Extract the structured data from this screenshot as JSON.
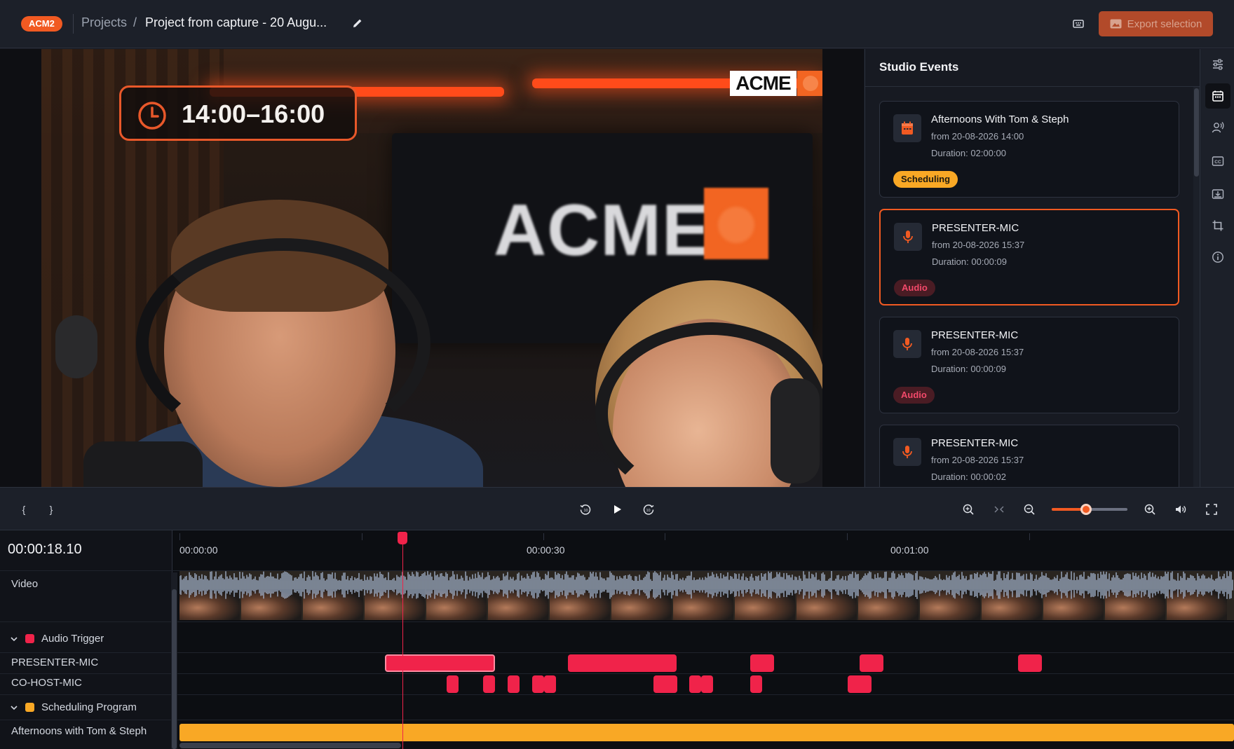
{
  "header": {
    "badge": "ACM2",
    "breadcrumb_projects": "Projects",
    "breadcrumb_sep": "/",
    "project_title": "Project from capture - 20 Augu...",
    "export_label": "Export selection"
  },
  "video": {
    "overlay_time": "14:00–16:00",
    "logo_text": "ACME",
    "monitor_text": "ACME"
  },
  "events_panel": {
    "title": "Studio Events",
    "events": [
      {
        "title": "Afternoons With Tom & Steph",
        "from": "from 20-08-2026 14:00",
        "duration": "Duration: 02:00:00",
        "tag": "Scheduling",
        "icon": "calendar-icon",
        "selected": false
      },
      {
        "title": "PRESENTER-MIC",
        "from": "from 20-08-2026 15:37",
        "duration": "Duration: 00:00:09",
        "tag": "Audio",
        "icon": "microphone-icon",
        "selected": true
      },
      {
        "title": "PRESENTER-MIC",
        "from": "from 20-08-2026 15:37",
        "duration": "Duration: 00:00:09",
        "tag": "Audio",
        "icon": "microphone-icon",
        "selected": false
      },
      {
        "title": "PRESENTER-MIC",
        "from": "from 20-08-2026 15:37",
        "duration": "Duration: 00:00:02",
        "tag": "",
        "icon": "microphone-icon",
        "selected": false
      }
    ]
  },
  "rail": [
    "sliders-icon",
    "calendar-icon",
    "speaker-person-icon",
    "closed-captions-icon",
    "image-download-icon",
    "crop-icon",
    "info-icon"
  ],
  "transport": {
    "mark_in": "{",
    "mark_out": "}",
    "zoom_level": 0.45
  },
  "timeline": {
    "timecode": "00:00:18.10",
    "ruler": [
      "00:00:00",
      "00:00:30",
      "00:01:00"
    ],
    "tracks": {
      "video": "Video",
      "audio_group": "Audio Trigger",
      "presenter": "PRESENTER-MIC",
      "cohost": "CO-HOST-MIC",
      "sched_group": "Scheduling Program",
      "sched_item": "Afternoons with Tom & Steph"
    }
  },
  "colors": {
    "accent": "#f15a22",
    "audio_clip": "#f0234a",
    "schedule_clip": "#f9a825"
  }
}
